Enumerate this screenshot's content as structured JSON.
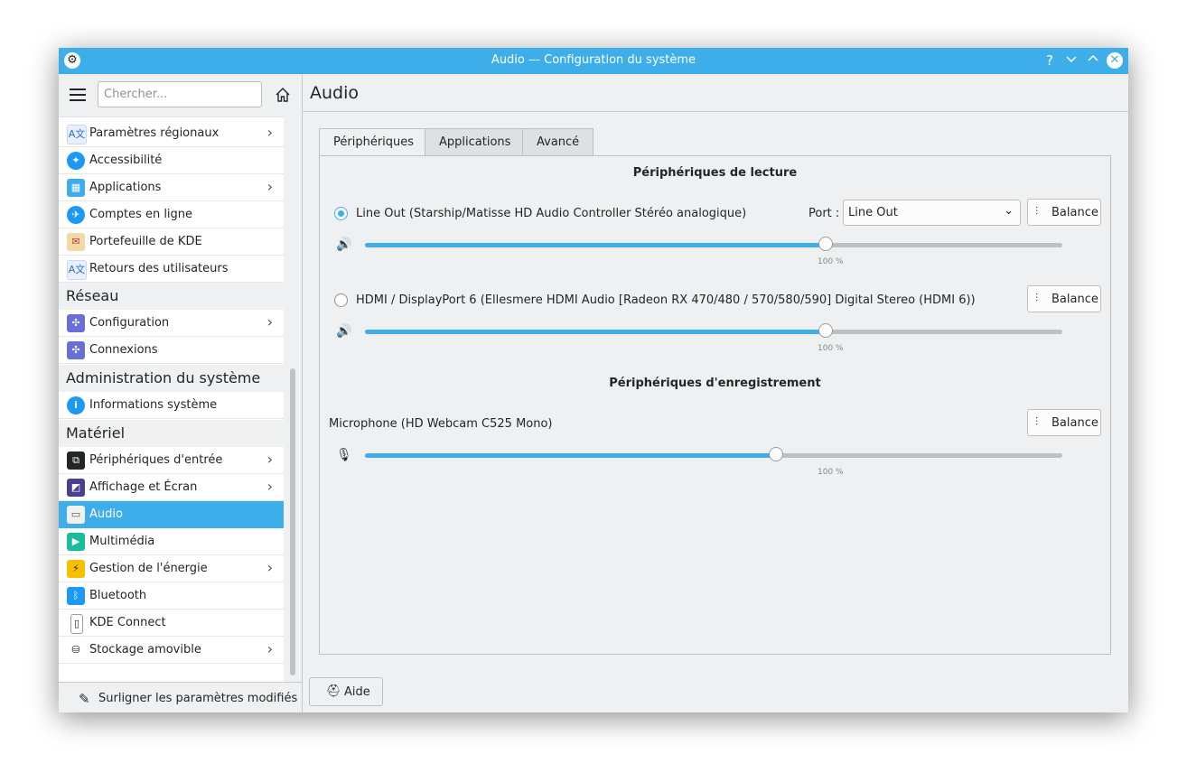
{
  "window": {
    "title": "Audio — Configuration du système"
  },
  "sidebar": {
    "search_placeholder": "Chercher...",
    "items": [
      {
        "label": "Paramètres régionaux",
        "icon": "language-icon",
        "chevron": true
      },
      {
        "label": "Accessibilité",
        "icon": "accessibility-icon",
        "chevron": false
      },
      {
        "label": "Applications",
        "icon": "applications-icon",
        "chevron": true
      },
      {
        "label": "Comptes en ligne",
        "icon": "online-accounts-icon",
        "chevron": false
      },
      {
        "label": "Portefeuille de KDE",
        "icon": "wallet-icon",
        "chevron": false
      },
      {
        "label": "Retours des utilisateurs",
        "icon": "feedback-icon",
        "chevron": false
      },
      {
        "label": "Configuration",
        "icon": "network-config-icon",
        "chevron": true
      },
      {
        "label": "Connexions",
        "icon": "connections-icon",
        "chevron": false
      },
      {
        "label": "Informations système",
        "icon": "info-icon",
        "chevron": false
      },
      {
        "label": "Périphériques d'entrée",
        "icon": "input-devices-icon",
        "chevron": true
      },
      {
        "label": "Affichage et Écran",
        "icon": "display-icon",
        "chevron": true
      },
      {
        "label": "Audio",
        "icon": "audio-icon",
        "chevron": false,
        "selected": true
      },
      {
        "label": "Multimédia",
        "icon": "multimedia-icon",
        "chevron": false
      },
      {
        "label": "Gestion de l'énergie",
        "icon": "power-icon",
        "chevron": true
      },
      {
        "label": "Bluetooth",
        "icon": "bluetooth-icon",
        "chevron": false
      },
      {
        "label": "KDE Connect",
        "icon": "kde-connect-icon",
        "chevron": false
      },
      {
        "label": "Stockage amovible",
        "icon": "usb-storage-icon",
        "chevron": true
      }
    ],
    "sections": {
      "network": "Réseau",
      "admin": "Administration du système",
      "hardware": "Matériel"
    },
    "footer_label": "Surligner les paramètres modifiés"
  },
  "main": {
    "title": "Audio",
    "tabs": [
      "Périphériques",
      "Applications",
      "Avancé"
    ],
    "playback_header": "Périphériques de lecture",
    "recording_header": "Périphériques d'enregistrement",
    "devices": [
      {
        "label": "Line Out (Starship/Matisse HD Audio Controller Stéréo analogique)",
        "volume": 66,
        "volume_text": "100 %",
        "checked": true
      },
      {
        "label": "HDMI / DisplayPort 6 (Ellesmere HDMI Audio [Radeon RX 470/480 / 570/580/590] Digital Stereo (HDMI 6))",
        "volume": 66,
        "volume_text": "100 %",
        "checked": false
      }
    ],
    "microphone": {
      "label": "Microphone (HD Webcam C525 Mono)",
      "volume": 59,
      "volume_text": "100 %"
    },
    "port_label": "Port :",
    "port_value": "Line Out",
    "balance_label": "Balance",
    "help_label": "Aide"
  },
  "colors": {
    "accent": "#3daee9",
    "window_bg": "#eff0f1"
  }
}
